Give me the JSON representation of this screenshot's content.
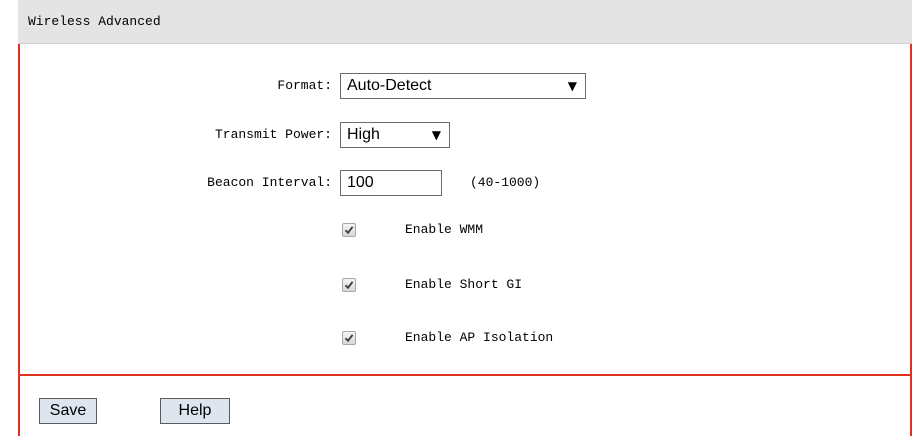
{
  "header": {
    "title": "Wireless Advanced"
  },
  "form": {
    "format": {
      "label": "Format:",
      "value": "Auto-Detect"
    },
    "transmit_power": {
      "label": "Transmit Power:",
      "value": "High"
    },
    "beacon_interval": {
      "label": "Beacon Interval:",
      "value": "100",
      "range_hint": "(40-1000)"
    },
    "checkboxes": [
      {
        "label": "Enable WMM",
        "checked": true
      },
      {
        "label": "Enable Short GI",
        "checked": true
      },
      {
        "label": "Enable AP Isolation",
        "checked": true
      }
    ]
  },
  "footer": {
    "save_label": "Save",
    "help_label": "Help"
  },
  "colors": {
    "accent_border": "#e0301e",
    "header_bg": "#e4e4e4",
    "button_bg": "#dde6ef"
  },
  "icons": {
    "dropdown": "dropdown-arrow-icon",
    "check": "checkmark-icon"
  }
}
